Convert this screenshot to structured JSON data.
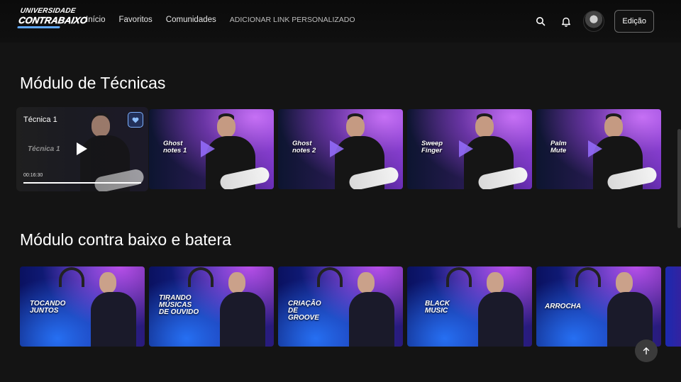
{
  "header": {
    "logo_line1": "UNIVERSIDADE",
    "logo_line2": "CONTRABAIXO",
    "nav": [
      {
        "label": "Início"
      },
      {
        "label": "Favoritos"
      },
      {
        "label": "Comunidades"
      },
      {
        "label": "ADICIONAR LINK PERSONALIZADO"
      }
    ],
    "edit_label": "Edição",
    "icons": {
      "search": "search-icon",
      "notifications": "bell-icon",
      "avatar": "avatar"
    }
  },
  "sections": [
    {
      "title": "Módulo de Técnicas",
      "featured": {
        "title": "Técnica 1",
        "thumb_label": "Técnica 1",
        "duration": "00:16:30",
        "progress": 1.0,
        "favorited": true
      },
      "cards": [
        {
          "label": "Ghost\nnotes 1"
        },
        {
          "label": "Ghost\nnotes 2"
        },
        {
          "label": "Sweep\nFinger"
        },
        {
          "label": "Palm\nMute"
        }
      ]
    },
    {
      "title": "Módulo contra baixo e batera",
      "cards": [
        {
          "label": "TOCANDO\nJUNTOS"
        },
        {
          "label": "TIRANDO\nMÚSICAS\nDE OUVIDO"
        },
        {
          "label": "CRIAÇÃO\nDE GROOVE"
        },
        {
          "label": "BLACK\nMUSIC"
        },
        {
          "label": "ARROCHA"
        }
      ]
    }
  ],
  "colors": {
    "background": "#141414",
    "accent": "#7fb2ff"
  }
}
